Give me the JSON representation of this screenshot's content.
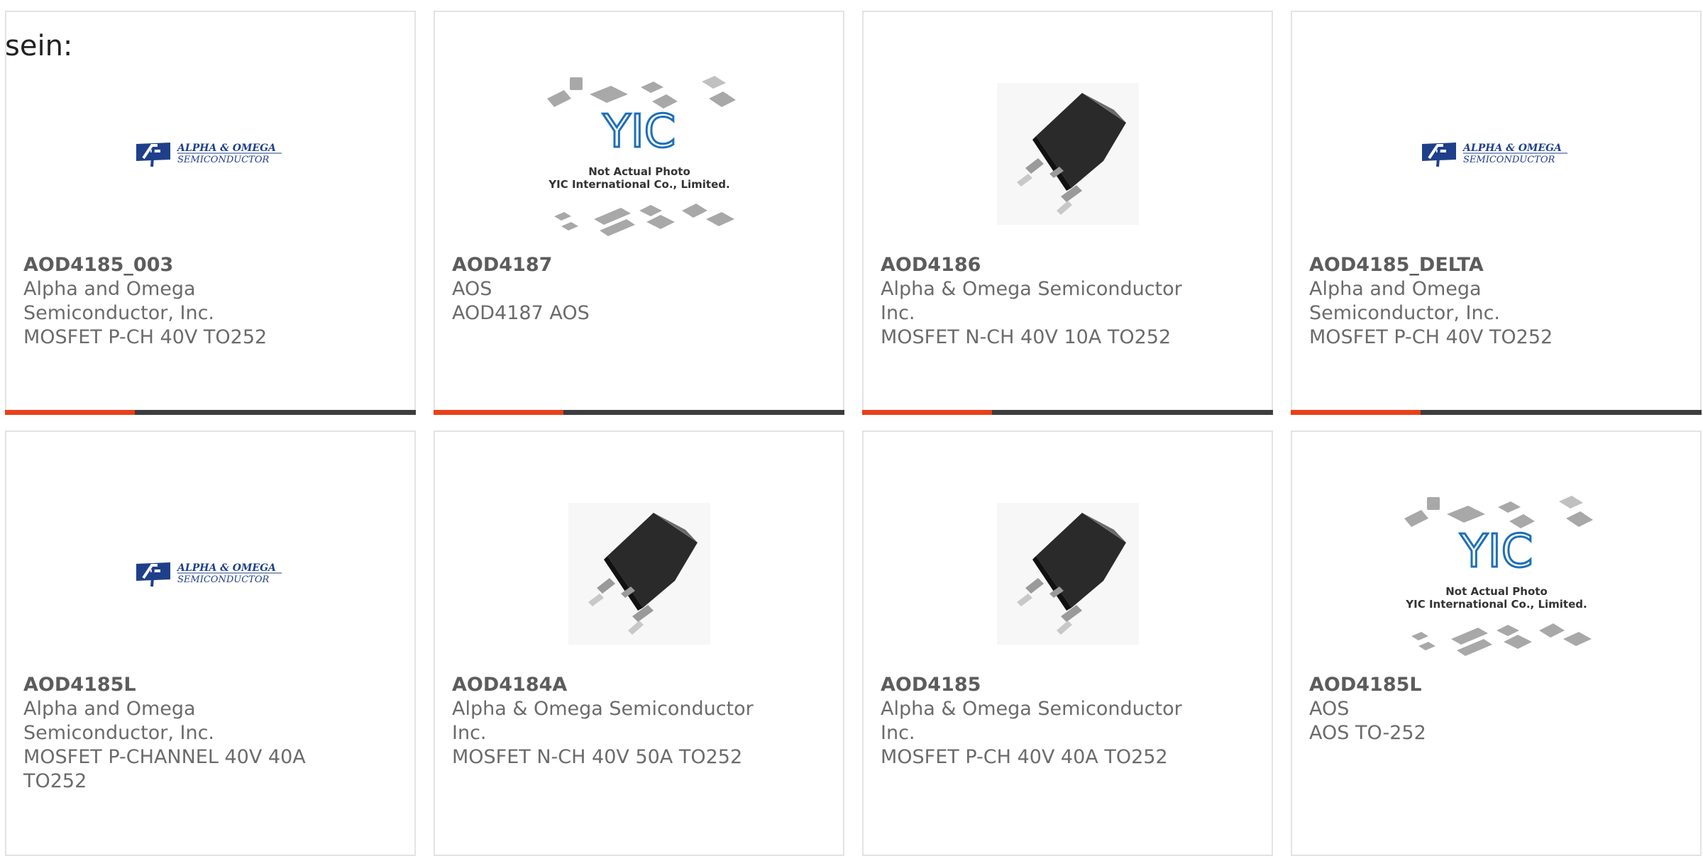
{
  "intro_text": "sein:",
  "logo_text": {
    "line1": "ALPHA & OMEGA",
    "line2": "SEMICONDUCTOR"
  },
  "placeholder_text": {
    "brand": "YIC",
    "line1": "Not Actual Photo",
    "line2": "YIC International Co., Limited."
  },
  "colors": {
    "accent": "#e8411a",
    "bar": "#3d3d3d",
    "logo_blue": "#1e3f8a",
    "yic_blue": "#1d6fb8"
  },
  "icons": {
    "logo": "alpha-omega-logo",
    "placeholder": "not-actual-photo-placeholder",
    "chip": "to252-package-photo"
  },
  "cards": [
    {
      "part": "AOD4185_003",
      "manufacturer": "Alpha and Omega Semiconductor, Inc.",
      "description": "MOSFET P-CH 40V TO252",
      "image": "logo"
    },
    {
      "part": "AOD4187",
      "manufacturer": "AOS",
      "description": "AOD4187 AOS",
      "image": "placeholder"
    },
    {
      "part": "AOD4186",
      "manufacturer": "Alpha & Omega Semiconductor Inc.",
      "description": "MOSFET N-CH 40V 10A TO252",
      "image": "chip"
    },
    {
      "part": "AOD4185_DELTA",
      "manufacturer": "Alpha and Omega Semiconductor, Inc.",
      "description": "MOSFET P-CH 40V TO252",
      "image": "logo"
    },
    {
      "part": "AOD4185L",
      "manufacturer": "Alpha and Omega Semiconductor, Inc.",
      "description": "MOSFET P-CHANNEL 40V 40A TO252",
      "image": "logo"
    },
    {
      "part": "AOD4184A",
      "manufacturer": "Alpha & Omega Semiconductor Inc.",
      "description": "MOSFET N-CH 40V 50A TO252",
      "image": "chip"
    },
    {
      "part": "AOD4185",
      "manufacturer": "Alpha & Omega Semiconductor Inc.",
      "description": "MOSFET P-CH 40V 40A TO252",
      "image": "chip"
    },
    {
      "part": "AOD4185L",
      "manufacturer": "AOS",
      "description": "AOS TO-252",
      "image": "placeholder"
    }
  ]
}
